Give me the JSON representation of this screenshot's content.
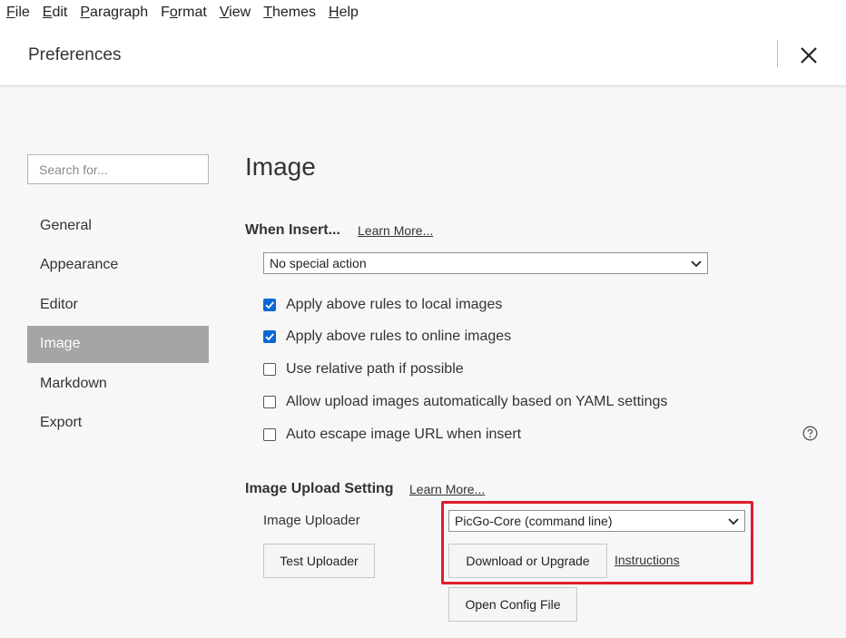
{
  "menubar": {
    "items": [
      {
        "mnemonic": "F",
        "rest": "ile"
      },
      {
        "mnemonic": "E",
        "rest": "dit"
      },
      {
        "mnemonic": "P",
        "rest": "aragraph"
      },
      {
        "pre": "F",
        "mnemonic": "o",
        "rest": "rmat"
      },
      {
        "mnemonic": "V",
        "rest": "iew"
      },
      {
        "mnemonic": "T",
        "rest": "hemes"
      },
      {
        "mnemonic": "H",
        "rest": "elp"
      }
    ]
  },
  "header": {
    "title": "Preferences",
    "close_icon": "close-icon"
  },
  "sidebar": {
    "search_placeholder": "Search for...",
    "items": [
      {
        "label": "General",
        "active": false
      },
      {
        "label": "Appearance",
        "active": false
      },
      {
        "label": "Editor",
        "active": false
      },
      {
        "label": "Image",
        "active": true
      },
      {
        "label": "Markdown",
        "active": false
      },
      {
        "label": "Export",
        "active": false
      }
    ]
  },
  "main": {
    "title": "Image",
    "when_insert": {
      "label": "When Insert...",
      "learn_more": "Learn More...",
      "selected": "No special action"
    },
    "checkboxes": [
      {
        "label": "Apply above rules to local images",
        "checked": true
      },
      {
        "label": "Apply above rules to online images",
        "checked": true
      },
      {
        "label": "Use relative path if possible",
        "checked": false
      },
      {
        "label": "Allow upload images automatically based on YAML settings",
        "checked": false
      },
      {
        "label": "Auto escape image URL when insert",
        "checked": false
      }
    ],
    "help_icon": "question-circle-icon",
    "upload": {
      "label": "Image Upload Setting",
      "learn_more": "Learn More...",
      "uploader_label": "Image Uploader",
      "uploader_selected": "PicGo-Core (command line)",
      "test_button": "Test Uploader",
      "download_button": "Download or Upgrade",
      "instructions_link": "Instructions",
      "config_button": "Open Config File"
    }
  },
  "colors": {
    "accent": "#0b68d6",
    "sidebar_active": "#a5a5a5",
    "highlight": "#e21b2a",
    "background": "#f7f7f7"
  }
}
